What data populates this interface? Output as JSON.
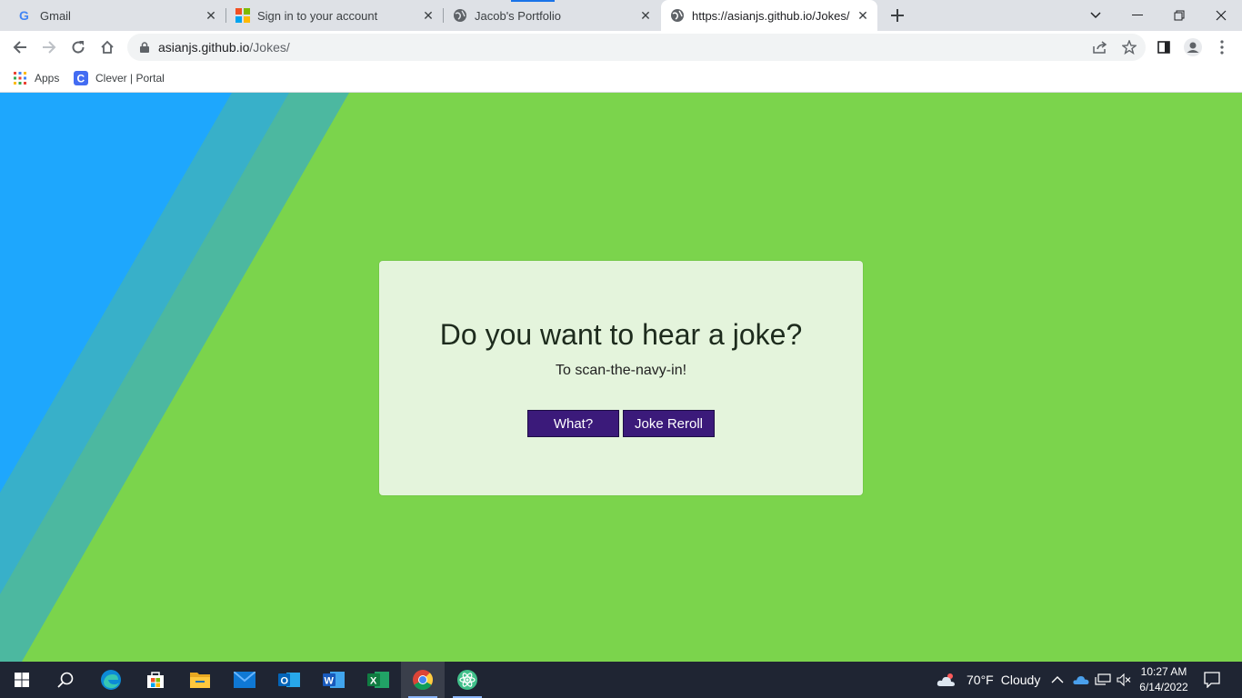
{
  "browser": {
    "tabs": [
      {
        "title": "Gmail",
        "favicon": "google-g-icon"
      },
      {
        "title": "Sign in to your account",
        "favicon": "microsoft-logo-icon"
      },
      {
        "title": "Jacob's Portfolio",
        "favicon": "globe-icon"
      },
      {
        "title": "https://asianjs.github.io/Jokes/",
        "favicon": "globe-icon",
        "active": true
      }
    ],
    "url_host": "asianjs.github.io",
    "url_path": "/Jokes/",
    "bookmarks": [
      {
        "label": "Apps",
        "icon": "apps-grid-icon"
      },
      {
        "label": "Clever | Portal",
        "icon": "clever-logo-icon"
      }
    ]
  },
  "page": {
    "heading": "Do you want to hear a joke?",
    "joke": "To scan-the-navy-in!",
    "buttons": {
      "what": "What?",
      "reroll": "Joke Reroll"
    },
    "colors": {
      "background": "#7bd44c",
      "card": "#e4f4dc",
      "button": "#3b1a7a",
      "stripe_blue": "#1ea7fd",
      "stripe_teal": "#3cb4c8"
    }
  },
  "taskbar": {
    "apps": [
      "start-icon",
      "search-icon",
      "edge-icon",
      "store-icon",
      "file-explorer-icon",
      "mail-icon",
      "outlook-icon",
      "word-icon",
      "excel-icon",
      "chrome-icon",
      "atom-icon"
    ],
    "weather": {
      "temp": "70°F",
      "condition": "Cloudy"
    },
    "time": "10:27 AM",
    "date": "6/14/2022"
  }
}
